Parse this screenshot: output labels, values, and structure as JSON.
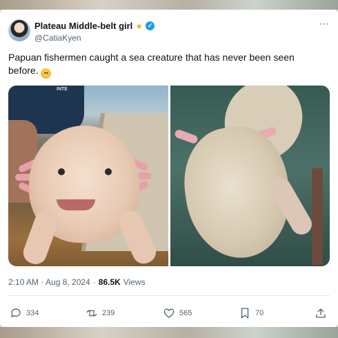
{
  "tweet": {
    "display_name": "Plateau Middle-belt girl",
    "handle": "@CatiaKyen",
    "text": "Papuan fishermen caught a sea creature that has never been seen before.",
    "more_menu": "⋯",
    "timestamp": "2:10 AM · Aug 8, 2024",
    "separator": "·",
    "views_count": "86.5K",
    "views_label": "Views",
    "emoji": "😨",
    "shirt_text": "INTE"
  },
  "actions": {
    "replies": "334",
    "reposts": "239",
    "likes": "565",
    "bookmarks": "70"
  },
  "icons": {
    "badge": "star-badge-icon",
    "verified": "verified-check-icon",
    "reply": "reply-icon",
    "repost": "repost-icon",
    "like": "heart-icon",
    "bookmark": "bookmark-icon",
    "share": "share-icon"
  },
  "colors": {
    "verified": "#1d9bf0",
    "badge": "#f4b400",
    "text": "#0f1419",
    "muted": "#536471"
  }
}
